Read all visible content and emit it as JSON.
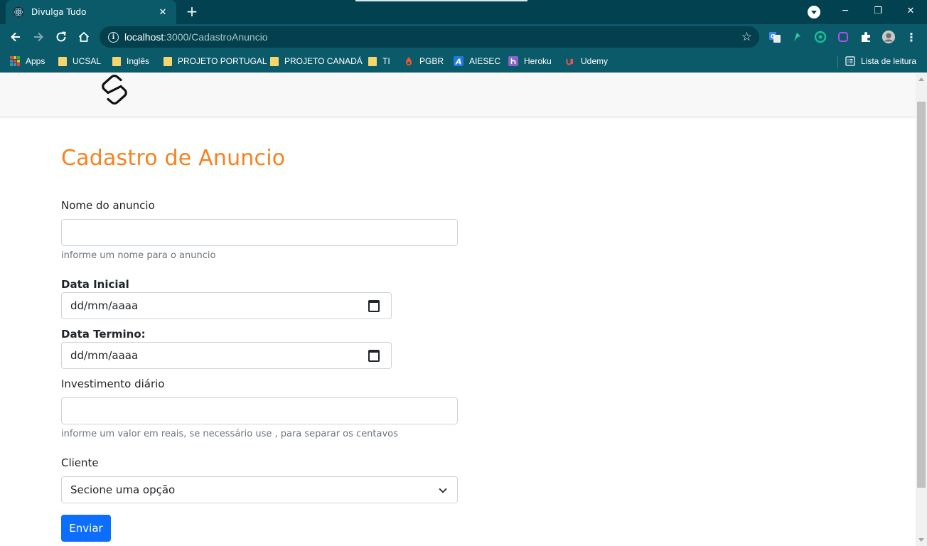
{
  "browser": {
    "tab_title": "Divulga Tudo",
    "tab_close": "✕",
    "new_tab": "+",
    "url_host": "localhost",
    "url_path": ":3000/CadastroAnuncio",
    "window_controls": {
      "minimize": "─",
      "restore": "❐",
      "close": "✕"
    },
    "bookmarks": [
      {
        "label": "Apps",
        "icon": "apps-grid-icon"
      },
      {
        "label": "UCSAL",
        "icon": "folder-icon"
      },
      {
        "label": "Inglês",
        "icon": "folder-icon"
      },
      {
        "label": "PROJETO PORTUGAL",
        "icon": "folder-icon"
      },
      {
        "label": "PROJETO CANADÁ",
        "icon": "folder-icon"
      },
      {
        "label": "TI",
        "icon": "folder-icon"
      },
      {
        "label": "PGBR",
        "icon": "pgbr-icon"
      },
      {
        "label": "AIESEC",
        "icon": "aiesec-icon"
      },
      {
        "label": "Heroku",
        "icon": "heroku-icon"
      },
      {
        "label": "Udemy",
        "icon": "udemy-icon"
      }
    ],
    "reading_list": "Lista de leitura",
    "colors": {
      "frame": "#02414f",
      "toolbar": "#0b5a6a"
    }
  },
  "form": {
    "title": "Cadastro de Anuncio",
    "nome_label": "Nome do anuncio",
    "nome_value": "",
    "nome_help": "informe um nome para o anuncio",
    "data_inicial_label": "Data Inicial",
    "data_inicial_placeholder": "dd/mm/aaaa",
    "data_termino_label": "Data Termino:",
    "data_termino_placeholder": "dd/mm/aaaa",
    "investimento_label": "Investimento diário",
    "investimento_value": "",
    "investimento_help": "informe um valor em reais, se necessário use , para separar os centavos",
    "cliente_label": "Cliente",
    "cliente_selected": "Secione uma opção",
    "submit_label": "Enviar",
    "colors": {
      "title": "#f6821f",
      "button": "#0d6efd"
    }
  }
}
